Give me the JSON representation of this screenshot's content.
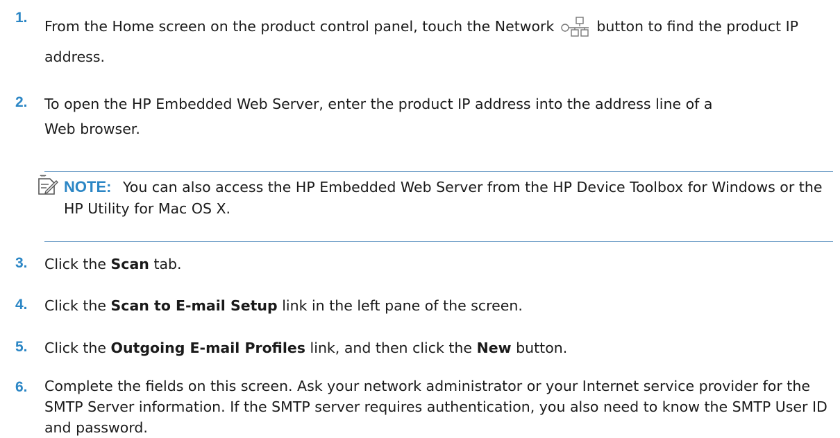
{
  "steps": [
    {
      "number": "1.",
      "parts": [
        "From the Home screen on the product control panel, touch the Network",
        "button to find the product IP address."
      ]
    },
    {
      "number": "2.",
      "text": "To open the HP Embedded Web Server, enter the product IP address into the address line of a Web browser."
    },
    {
      "number": "3.",
      "parts": [
        "Click the",
        "Scan",
        "tab."
      ]
    },
    {
      "number": "4.",
      "parts": [
        "Click the",
        "Scan to E-mail Setup",
        "link in the left pane of the screen."
      ]
    },
    {
      "number": "5.",
      "parts": [
        "Click the",
        "Outgoing E-mail Profiles",
        "link, and then click the",
        "New",
        "button."
      ]
    },
    {
      "number": "6.",
      "text": "Complete the fields on this screen. Ask your network administrator or your Internet service provider for the SMTP Server information. If the SMTP server requires authentication, you also need to know the SMTP User ID and password."
    }
  ],
  "note": {
    "label": "NOTE:",
    "text": "You can also access the HP Embedded Web Server from the HP Device Toolbox for Windows or the HP Utility for Mac OS X."
  },
  "icons": [
    "network-icon",
    "note-icon"
  ],
  "colors": {
    "accent": "#2b86c5",
    "rule": "#7ba7cc",
    "text": "#1a1a1a"
  }
}
